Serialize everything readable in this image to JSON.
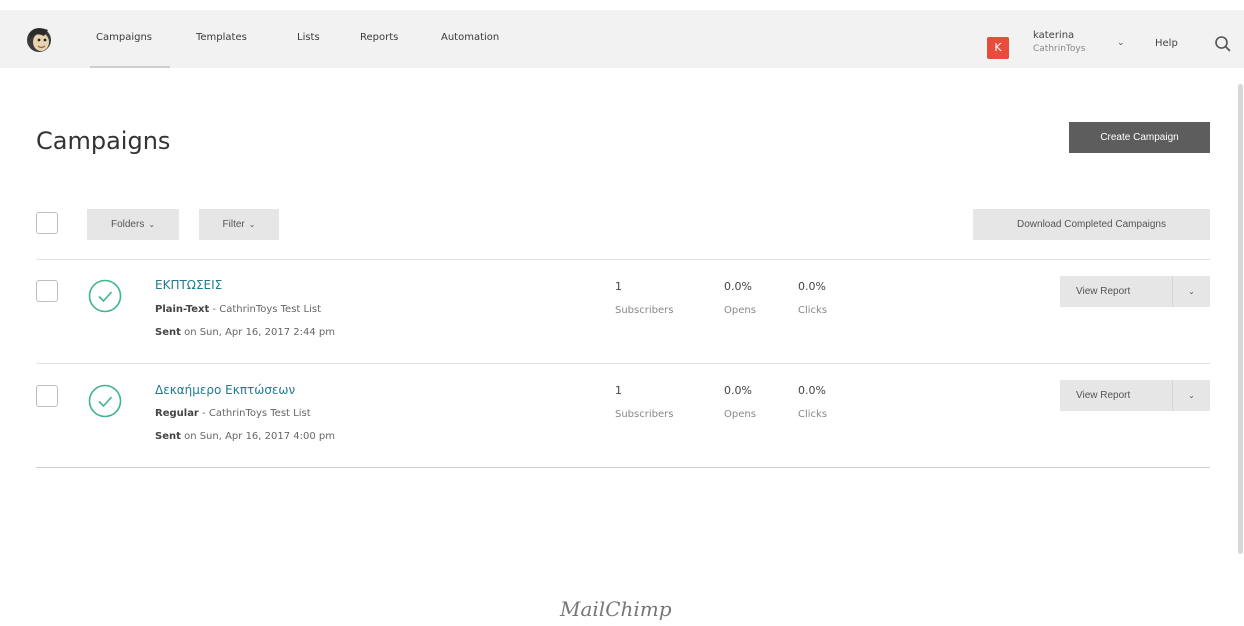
{
  "nav": {
    "items": [
      "Campaigns",
      "Templates",
      "Lists",
      "Reports",
      "Automation"
    ],
    "user": {
      "initial": "K",
      "name": "katerina",
      "account": "CathrinToys"
    },
    "help": "Help",
    "icons": {
      "logo": "mailchimp-freddie-icon",
      "search": "search-icon",
      "chevron": "chevron-down-icon"
    }
  },
  "page": {
    "title": "Campaigns",
    "create_button": "Create Campaign"
  },
  "toolbar": {
    "folders": "Folders",
    "filter": "Filter",
    "download": "Download Completed Campaigns"
  },
  "campaigns": [
    {
      "name": "ΕΚΠΤΩΣΕΙΣ",
      "type": "Plain-Text",
      "list": " - CathrinToys Test List",
      "sent_label": "Sent",
      "sent_date": " on Sun, Apr 16, 2017 2:44 pm",
      "subscribers": "1",
      "subscribers_label": "Subscribers",
      "opens": "0.0%",
      "opens_label": "Opens",
      "clicks": "0.0%",
      "clicks_label": "Clicks",
      "action": "View Report"
    },
    {
      "name": "Δεκαήμερο Εκπτώσεων",
      "type": "Regular",
      "list": " - CathrinToys Test List",
      "sent_label": "Sent",
      "sent_date": " on Sun, Apr 16, 2017 4:00 pm",
      "subscribers": "1",
      "subscribers_label": "Subscribers",
      "opens": "0.0%",
      "opens_label": "Opens",
      "clicks": "0.0%",
      "clicks_label": "Clicks",
      "action": "View Report"
    }
  ],
  "footer": {
    "brand": "MailChimp"
  },
  "colors": {
    "accent": "#1f7b8f",
    "status_ok": "#3fb48f",
    "avatar": "#e84c3d",
    "primary_button": "#5d5d5d"
  }
}
